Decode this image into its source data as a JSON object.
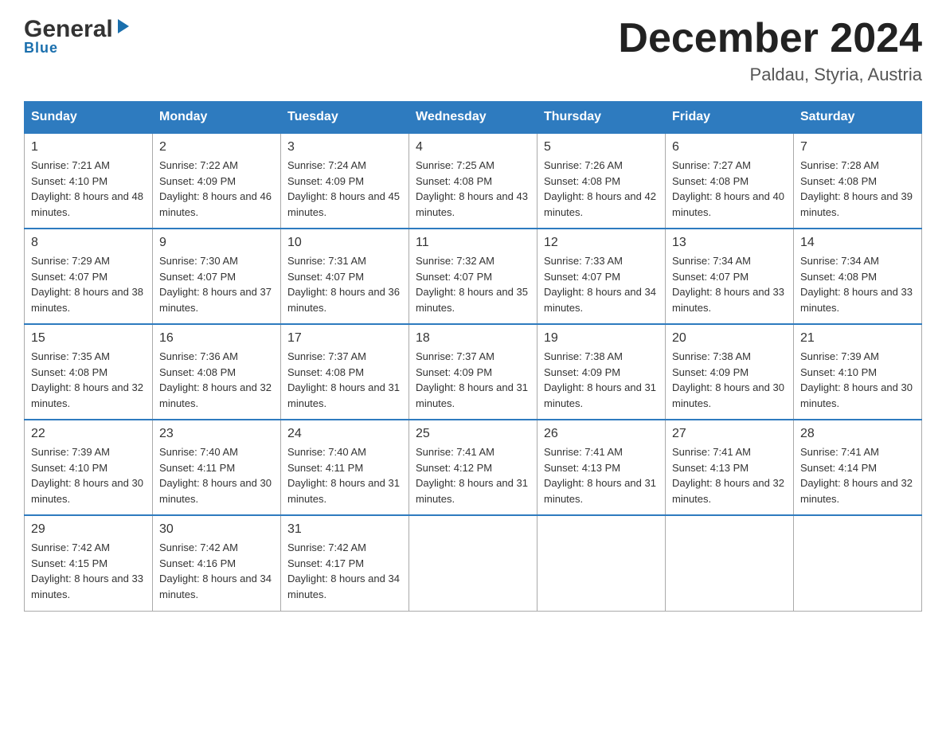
{
  "logo": {
    "general": "General",
    "blue": "Blue",
    "triangle": "▶"
  },
  "header": {
    "title": "December 2024",
    "subtitle": "Paldau, Styria, Austria"
  },
  "weekdays": [
    "Sunday",
    "Monday",
    "Tuesday",
    "Wednesday",
    "Thursday",
    "Friday",
    "Saturday"
  ],
  "weeks": [
    [
      {
        "day": "1",
        "sunrise": "7:21 AM",
        "sunset": "4:10 PM",
        "daylight": "8 hours and 48 minutes."
      },
      {
        "day": "2",
        "sunrise": "7:22 AM",
        "sunset": "4:09 PM",
        "daylight": "8 hours and 46 minutes."
      },
      {
        "day": "3",
        "sunrise": "7:24 AM",
        "sunset": "4:09 PM",
        "daylight": "8 hours and 45 minutes."
      },
      {
        "day": "4",
        "sunrise": "7:25 AM",
        "sunset": "4:08 PM",
        "daylight": "8 hours and 43 minutes."
      },
      {
        "day": "5",
        "sunrise": "7:26 AM",
        "sunset": "4:08 PM",
        "daylight": "8 hours and 42 minutes."
      },
      {
        "day": "6",
        "sunrise": "7:27 AM",
        "sunset": "4:08 PM",
        "daylight": "8 hours and 40 minutes."
      },
      {
        "day": "7",
        "sunrise": "7:28 AM",
        "sunset": "4:08 PM",
        "daylight": "8 hours and 39 minutes."
      }
    ],
    [
      {
        "day": "8",
        "sunrise": "7:29 AM",
        "sunset": "4:07 PM",
        "daylight": "8 hours and 38 minutes."
      },
      {
        "day": "9",
        "sunrise": "7:30 AM",
        "sunset": "4:07 PM",
        "daylight": "8 hours and 37 minutes."
      },
      {
        "day": "10",
        "sunrise": "7:31 AM",
        "sunset": "4:07 PM",
        "daylight": "8 hours and 36 minutes."
      },
      {
        "day": "11",
        "sunrise": "7:32 AM",
        "sunset": "4:07 PM",
        "daylight": "8 hours and 35 minutes."
      },
      {
        "day": "12",
        "sunrise": "7:33 AM",
        "sunset": "4:07 PM",
        "daylight": "8 hours and 34 minutes."
      },
      {
        "day": "13",
        "sunrise": "7:34 AM",
        "sunset": "4:07 PM",
        "daylight": "8 hours and 33 minutes."
      },
      {
        "day": "14",
        "sunrise": "7:34 AM",
        "sunset": "4:08 PM",
        "daylight": "8 hours and 33 minutes."
      }
    ],
    [
      {
        "day": "15",
        "sunrise": "7:35 AM",
        "sunset": "4:08 PM",
        "daylight": "8 hours and 32 minutes."
      },
      {
        "day": "16",
        "sunrise": "7:36 AM",
        "sunset": "4:08 PM",
        "daylight": "8 hours and 32 minutes."
      },
      {
        "day": "17",
        "sunrise": "7:37 AM",
        "sunset": "4:08 PM",
        "daylight": "8 hours and 31 minutes."
      },
      {
        "day": "18",
        "sunrise": "7:37 AM",
        "sunset": "4:09 PM",
        "daylight": "8 hours and 31 minutes."
      },
      {
        "day": "19",
        "sunrise": "7:38 AM",
        "sunset": "4:09 PM",
        "daylight": "8 hours and 31 minutes."
      },
      {
        "day": "20",
        "sunrise": "7:38 AM",
        "sunset": "4:09 PM",
        "daylight": "8 hours and 30 minutes."
      },
      {
        "day": "21",
        "sunrise": "7:39 AM",
        "sunset": "4:10 PM",
        "daylight": "8 hours and 30 minutes."
      }
    ],
    [
      {
        "day": "22",
        "sunrise": "7:39 AM",
        "sunset": "4:10 PM",
        "daylight": "8 hours and 30 minutes."
      },
      {
        "day": "23",
        "sunrise": "7:40 AM",
        "sunset": "4:11 PM",
        "daylight": "8 hours and 30 minutes."
      },
      {
        "day": "24",
        "sunrise": "7:40 AM",
        "sunset": "4:11 PM",
        "daylight": "8 hours and 31 minutes."
      },
      {
        "day": "25",
        "sunrise": "7:41 AM",
        "sunset": "4:12 PM",
        "daylight": "8 hours and 31 minutes."
      },
      {
        "day": "26",
        "sunrise": "7:41 AM",
        "sunset": "4:13 PM",
        "daylight": "8 hours and 31 minutes."
      },
      {
        "day": "27",
        "sunrise": "7:41 AM",
        "sunset": "4:13 PM",
        "daylight": "8 hours and 32 minutes."
      },
      {
        "day": "28",
        "sunrise": "7:41 AM",
        "sunset": "4:14 PM",
        "daylight": "8 hours and 32 minutes."
      }
    ],
    [
      {
        "day": "29",
        "sunrise": "7:42 AM",
        "sunset": "4:15 PM",
        "daylight": "8 hours and 33 minutes."
      },
      {
        "day": "30",
        "sunrise": "7:42 AM",
        "sunset": "4:16 PM",
        "daylight": "8 hours and 34 minutes."
      },
      {
        "day": "31",
        "sunrise": "7:42 AM",
        "sunset": "4:17 PM",
        "daylight": "8 hours and 34 minutes."
      },
      null,
      null,
      null,
      null
    ]
  ],
  "labels": {
    "sunrise": "Sunrise:",
    "sunset": "Sunset:",
    "daylight": "Daylight:"
  },
  "colors": {
    "header_bg": "#2e7bbf",
    "header_text": "#ffffff",
    "border": "#aaaaaa",
    "accent": "#2e7bbf"
  }
}
